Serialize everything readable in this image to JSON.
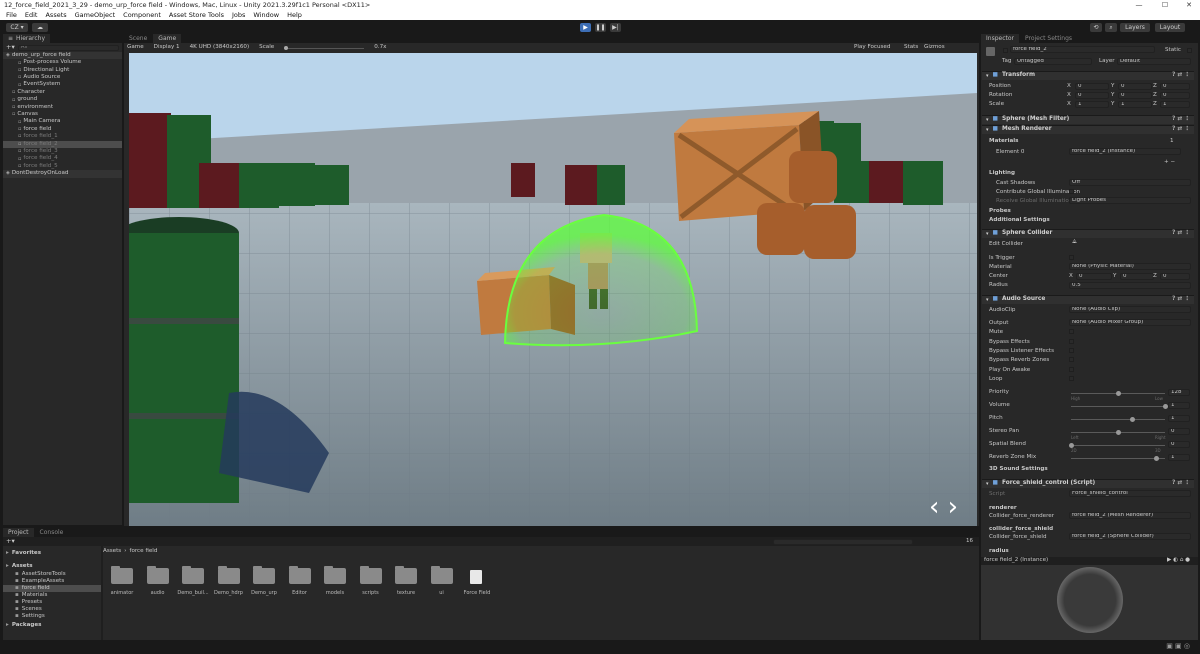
{
  "window": {
    "title": "12_force_field_2021_3_29 - demo_urp_force field - Windows, Mac, Linux - Unity 2021.3.29f1c1 Personal <DX11>"
  },
  "menu": [
    "File",
    "Edit",
    "Assets",
    "GameObject",
    "Component",
    "Asset Store Tools",
    "Jobs",
    "Window",
    "Help"
  ],
  "toolbar": {
    "account": "CZ ▾",
    "layers": "Layers",
    "layout": "Layout"
  },
  "hierarchy": {
    "tab": "Hierarchy",
    "search": "All",
    "items": [
      {
        "label": "demo_urp_force field",
        "indent": 0,
        "kind": "scene"
      },
      {
        "label": "Post-process Volume",
        "indent": 2
      },
      {
        "label": "Directional Light",
        "indent": 2
      },
      {
        "label": "Audio Source",
        "indent": 2
      },
      {
        "label": "EventSystem",
        "indent": 2
      },
      {
        "label": "Character",
        "indent": 1
      },
      {
        "label": "ground",
        "indent": 1
      },
      {
        "label": "environment",
        "indent": 1
      },
      {
        "label": "Canvas",
        "indent": 1
      },
      {
        "label": "Main Camera",
        "indent": 2
      },
      {
        "label": "force field",
        "indent": 2
      },
      {
        "label": "force field_1",
        "indent": 2,
        "dim": true
      },
      {
        "label": "force field_2",
        "indent": 2,
        "dim": true,
        "selected": true
      },
      {
        "label": "force field_3",
        "indent": 2,
        "dim": true
      },
      {
        "label": "force field_4",
        "indent": 2,
        "dim": true
      },
      {
        "label": "force field_5",
        "indent": 2,
        "dim": true
      },
      {
        "label": "DontDestroyOnLoad",
        "indent": 0,
        "kind": "scene"
      }
    ]
  },
  "game": {
    "tabs": [
      "Scene",
      "Game"
    ],
    "mode": "Game",
    "display": "Display 1",
    "resolution": "4K UHD (3840x2160)",
    "scale_label": "Scale",
    "scale_value": "0.7x",
    "play_focused": "Play Focused",
    "stats": "Stats",
    "gizmos": "Gizmos"
  },
  "project": {
    "tabs": [
      "Project",
      "Console"
    ],
    "breadcrumb_root": "Assets",
    "breadcrumb_sep": "›",
    "breadcrumb_leaf": "force field",
    "count": "16",
    "tree": [
      {
        "label": "Favorites",
        "indent": 0,
        "bold": true
      },
      {
        "label": "Assets",
        "indent": 0,
        "bold": true
      },
      {
        "label": "AssetStoreTools",
        "indent": 1
      },
      {
        "label": "ExampleAssets",
        "indent": 1
      },
      {
        "label": "force field",
        "indent": 1,
        "selected": true
      },
      {
        "label": "Materials",
        "indent": 1
      },
      {
        "label": "Presets",
        "indent": 1
      },
      {
        "label": "Scenes",
        "indent": 1
      },
      {
        "label": "Settings",
        "indent": 1
      },
      {
        "label": "Packages",
        "indent": 0,
        "bold": true
      }
    ],
    "assets": [
      "animator",
      "audio",
      "Demo_buil...",
      "Demo_hdrp",
      "Demo_urp",
      "Editor",
      "models",
      "scripts",
      "texture",
      "ui",
      "Force Field"
    ]
  },
  "inspector": {
    "tabs": [
      "Inspector",
      "Project Settings"
    ],
    "object_name": "force field_2",
    "static": "Static",
    "tag_label": "Tag",
    "tag": "Untagged",
    "layer_label": "Layer",
    "layer": "Default",
    "transform": {
      "title": "Transform",
      "position": {
        "label": "Position",
        "x": "0",
        "y": "0",
        "z": "0"
      },
      "rotation": {
        "label": "Rotation",
        "x": "0",
        "y": "0",
        "z": "0"
      },
      "scale": {
        "label": "Scale",
        "x": "1",
        "y": "1",
        "z": "1"
      }
    },
    "mesh_filter": "Sphere (Mesh Filter)",
    "mesh_renderer": {
      "title": "Mesh Renderer",
      "materials": "Materials",
      "materials_count": "1",
      "element0_label": "Element 0",
      "element0": "force field_2 (Instance)",
      "lighting": "Lighting",
      "cast_shadows_label": "Cast Shadows",
      "cast_shadows": "Off",
      "contribute_gi": "Contribute Global Illumination",
      "receive_gi_label": "Receive Global Illumination",
      "receive_gi": "Light Probes",
      "probes": "Probes",
      "additional": "Additional Settings"
    },
    "sphere_collider": {
      "title": "Sphere Collider",
      "edit": "Edit Collider",
      "is_trigger": "Is Trigger",
      "material_label": "Material",
      "material": "None (Physic Material)",
      "center_label": "Center",
      "cx": "0",
      "cy": "0",
      "cz": "0",
      "radius_label": "Radius",
      "radius": "0.5"
    },
    "audio_source": {
      "title": "Audio Source",
      "clip_label": "AudioClip",
      "clip": "None (Audio Clip)",
      "output_label": "Output",
      "output": "None (Audio Mixer Group)",
      "mute": "Mute",
      "bypass_effects": "Bypass Effects",
      "bypass_listener": "Bypass Listener Effects",
      "bypass_reverb": "Bypass Reverb Zones",
      "play_on_awake": "Play On Awake",
      "loop": "Loop",
      "priority_label": "Priority",
      "priority": "128",
      "priority_min": "High",
      "priority_max": "Low",
      "volume_label": "Volume",
      "volume": "1",
      "pitch_label": "Pitch",
      "pitch": "1",
      "stereo_label": "Stereo Pan",
      "stereo": "0",
      "stereo_min": "Left",
      "stereo_max": "Right",
      "spatial_label": "Spatial Blend",
      "spatial": "0",
      "spatial_min": "2D",
      "spatial_max": "3D",
      "reverb_label": "Reverb Zone Mix",
      "reverb": "1",
      "sound3d": "3D Sound Settings"
    },
    "script": {
      "title": "Force_shield_control (Script)",
      "script_label": "Script",
      "script": "Force_shield_control",
      "renderer_header": "renderer",
      "renderer_label": "Collider_force_renderer",
      "renderer": "force field_2 (Mesh Renderer)",
      "collider_header": "collider_force_shield",
      "collider_label": "Collider_force_shield",
      "collider": "force field_2 (Sphere Collider)",
      "radius_header": "radius"
    },
    "preview_title": "force field_2 (Instance)"
  },
  "colors": {
    "shield": "#5cff3a",
    "sky": "#b9d4ea",
    "floor": "#8b9aa4",
    "barrel_green": "#1e5c2b",
    "barrel_red": "#5c1a1f",
    "crate": "#c07a3f",
    "accent": "#3d6eb5"
  }
}
